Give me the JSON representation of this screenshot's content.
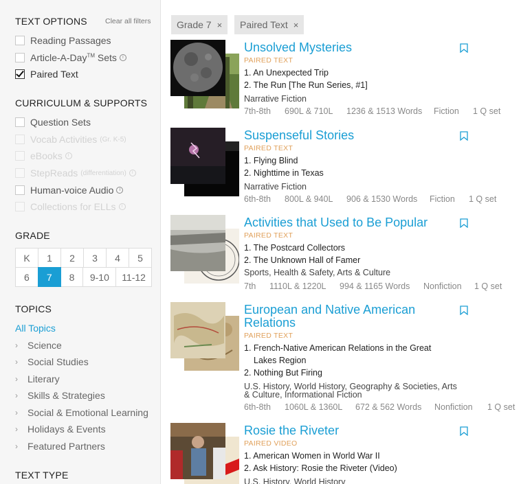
{
  "sidebar": {
    "text_options": {
      "title": "TEXT OPTIONS",
      "clear": "Clear all filters",
      "items": [
        {
          "label": "Reading Passages",
          "checked": false
        },
        {
          "label": "Article-A-Day",
          "sup": "TM",
          "suffix": " Sets",
          "checked": false
        },
        {
          "label": "Paired Text",
          "checked": true
        }
      ]
    },
    "curriculum": {
      "title": "CURRICULUM & SUPPORTS",
      "items": [
        {
          "label": "Question Sets"
        },
        {
          "label": "Vocab Activities",
          "sub": "(Gr. K-5)"
        },
        {
          "label": "eBooks"
        },
        {
          "label": "StepReads",
          "sub": "(differentiation)"
        },
        {
          "label": "Human-voice Audio"
        },
        {
          "label": "Collections for ELLs"
        }
      ]
    },
    "grade": {
      "title": "GRADE",
      "row1": [
        "K",
        "1",
        "2",
        "3",
        "4",
        "5"
      ],
      "row2": [
        "6",
        "7",
        "8",
        "9-10",
        "11-12"
      ],
      "selected": "7"
    },
    "topics": {
      "title": "TOPICS",
      "all": "All Topics",
      "items": [
        "Science",
        "Social Studies",
        "Literary",
        "Skills & Strategies",
        "Social & Emotional Learning",
        "Holidays & Events",
        "Featured Partners"
      ]
    },
    "text_type": {
      "title": "TEXT TYPE"
    }
  },
  "chips": [
    {
      "label": "Grade 7"
    },
    {
      "label": "Paired Text"
    }
  ],
  "close_glyph": "×",
  "accent_color": "#1a9ed4",
  "results": [
    {
      "title": "Unsolved Mysteries",
      "kind": "PAIRED TEXT",
      "items": [
        "1. An Unexpected Trip",
        "2. The Run [The Run Series, #1]"
      ],
      "genre": "Narrative Fiction",
      "grades": "7th-8th",
      "lexile": "690L & 710L",
      "words": "1236 & 1513 Words",
      "type": "Fiction",
      "qsets": "1 Q set"
    },
    {
      "title": "Suspenseful Stories",
      "kind": "PAIRED TEXT",
      "items": [
        "1. Flying Blind",
        "2. Nighttime in Texas"
      ],
      "genre": "Narrative Fiction",
      "grades": "6th-8th",
      "lexile": "800L & 940L",
      "words": "906 & 1530 Words",
      "type": "Fiction",
      "qsets": "1 Q set"
    },
    {
      "title": "Activities that Used to Be Popular",
      "kind": "PAIRED TEXT",
      "items": [
        "1. The Postcard Collectors",
        "2. The Unknown Hall of Famer"
      ],
      "genre": "Sports, Health & Safety, Arts & Culture",
      "grades": "7th",
      "lexile": "1110L & 1220L",
      "words": "994 & 1165 Words",
      "type": "Nonfiction",
      "qsets": "1 Q set"
    },
    {
      "title_line1": "European and Native American",
      "title_line2": "Relations",
      "kind": "PAIRED TEXT",
      "item1_line1": "1. French-Native American Relations in the Great",
      "item1_line2": "Lakes Region",
      "item2": "2. Nothing But Firing",
      "genre_line1": "U.S. History, World History, Geography & Societies, Arts",
      "genre_line2": "& Culture, Informational Fiction",
      "grades": "6th-8th",
      "lexile": "1060L & 1360L",
      "words": "672 & 562 Words",
      "type": "Nonfiction",
      "qsets": "1 Q set"
    },
    {
      "title": "Rosie the Riveter",
      "kind": "PAIRED VIDEO",
      "items": [
        "1. American Women in World War II",
        "2. Ask History: Rosie the Riveter (Video)"
      ],
      "genre": "U.S. History, World History"
    }
  ]
}
